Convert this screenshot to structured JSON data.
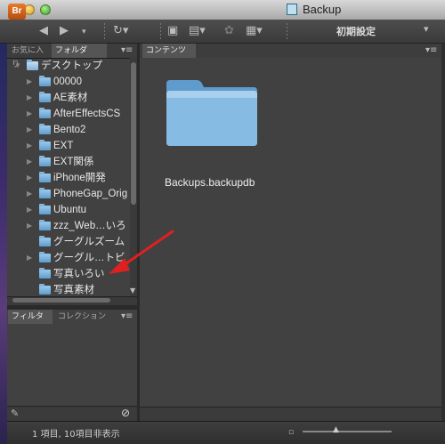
{
  "window": {
    "title": "Backup"
  },
  "toolbar": {
    "app_badge": "Br",
    "workspace_label": "初期設定"
  },
  "left_top": {
    "tabs": [
      {
        "label": "お気に入り"
      },
      {
        "label": "フォルダ"
      }
    ],
    "tree": [
      {
        "label": "デスクトップ",
        "expanded": true
      },
      {
        "label": "00000"
      },
      {
        "label": "AE素材"
      },
      {
        "label": "AfterEffectsCS"
      },
      {
        "label": "Bento2"
      },
      {
        "label": "EXT"
      },
      {
        "label": "EXT関係"
      },
      {
        "label": "iPhone開発"
      },
      {
        "label": "PhoneGap_Orig"
      },
      {
        "label": "Ubuntu"
      },
      {
        "label": "zzz_Web…いろ"
      },
      {
        "label": "グーグルズーム"
      },
      {
        "label": "グーグル…トビ"
      },
      {
        "label": "写真いろい"
      },
      {
        "label": "写真素材"
      }
    ]
  },
  "left_bottom": {
    "tabs": [
      {
        "label": "フィルタ"
      },
      {
        "label": "コレクション"
      }
    ]
  },
  "content": {
    "tab_label": "コンテンツ",
    "items": [
      {
        "name": "Backups.backupdb",
        "icon": "folder-icon"
      }
    ]
  },
  "status": {
    "text": "1 項目, 10項目非表示"
  },
  "colors": {
    "accent_badge": "#c85a18",
    "folder": "#6aa6d6",
    "annotation_arrow": "#e02020"
  }
}
